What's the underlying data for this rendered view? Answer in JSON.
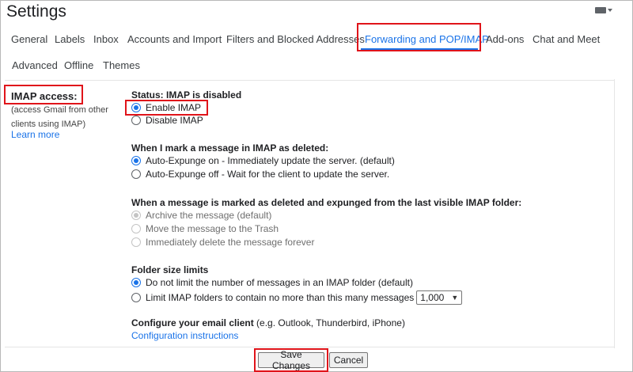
{
  "window": {
    "title": "Settings"
  },
  "colors": {
    "accent": "#1a73e8",
    "highlight": "#e0141a"
  },
  "tabs": [
    {
      "label": "General"
    },
    {
      "label": "Labels"
    },
    {
      "label": "Inbox"
    },
    {
      "label": "Accounts and Import"
    },
    {
      "label": "Filters and Blocked Addresses"
    },
    {
      "label": "Forwarding and POP/IMAP",
      "active": true
    },
    {
      "label": "Add-ons"
    },
    {
      "label": "Chat and Meet"
    },
    {
      "label": "Advanced"
    },
    {
      "label": "Offline"
    },
    {
      "label": "Themes"
    }
  ],
  "imap": {
    "label": "IMAP access:",
    "description": "(access Gmail from other clients using IMAP)",
    "learn_more": "Learn more",
    "status": "Status: IMAP is disabled",
    "enable": "Enable IMAP",
    "disable": "Disable IMAP"
  },
  "deleted": {
    "heading": "When I mark a message in IMAP as deleted:",
    "options": [
      "Auto-Expunge on - Immediately update the server. (default)",
      "Auto-Expunge off - Wait for the client to update the server."
    ]
  },
  "expunged": {
    "heading": "When a message is marked as deleted and expunged from the last visible IMAP folder:",
    "options": [
      "Archive the message (default)",
      "Move the message to the Trash",
      "Immediately delete the message forever"
    ]
  },
  "folder": {
    "heading": "Folder size limits",
    "options": [
      "Do not limit the number of messages in an IMAP folder (default)",
      "Limit IMAP folders to contain no more than this many messages"
    ],
    "limit_value": "1,000"
  },
  "client": {
    "heading": "Configure your email client",
    "examples": "(e.g. Outlook, Thunderbird, iPhone)",
    "instructions": "Configuration instructions"
  },
  "buttons": {
    "save": "Save Changes",
    "cancel": "Cancel"
  },
  "icons": {
    "keyboard": "keyboard-icon",
    "dropdown": "chevron-down-icon"
  }
}
